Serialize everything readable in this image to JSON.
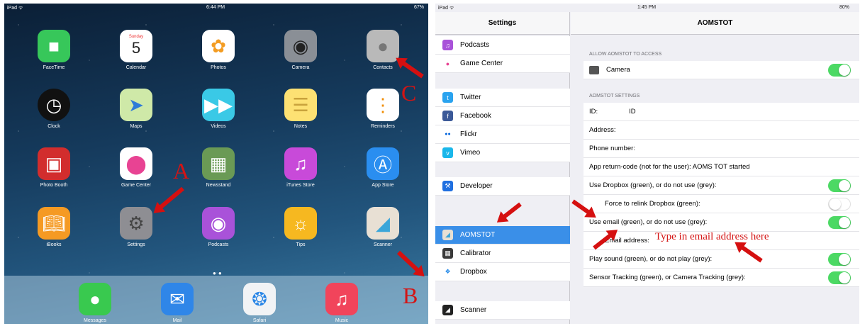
{
  "home": {
    "status": {
      "left": "iPad ᯤ",
      "time": "6:44 PM",
      "battery": "67%"
    },
    "apps": [
      {
        "label": "FaceTime",
        "icon": "facetime-icon",
        "color": "#37c75a"
      },
      {
        "label": "Calendar",
        "icon": "calendar-icon",
        "color": "#ffffff",
        "day": "Sunday",
        "date": "5"
      },
      {
        "label": "Photos",
        "icon": "photos-icon",
        "color": "#ffffff"
      },
      {
        "label": "Camera",
        "icon": "camera-icon",
        "color": "#8a8f96"
      },
      {
        "label": "Contacts",
        "icon": "contacts-icon",
        "color": "#b9b9b9"
      },
      {
        "label": "Clock",
        "icon": "clock-icon",
        "color": "#111111"
      },
      {
        "label": "Maps",
        "icon": "maps-icon",
        "color": "#cfe9a8"
      },
      {
        "label": "Videos",
        "icon": "videos-icon",
        "color": "#3ac9e6"
      },
      {
        "label": "Notes",
        "icon": "notes-icon",
        "color": "#fde173"
      },
      {
        "label": "Reminders",
        "icon": "reminders-icon",
        "color": "#ffffff"
      },
      {
        "label": "Photo Booth",
        "icon": "photo-booth-icon",
        "color": "#d22d2d"
      },
      {
        "label": "Game Center",
        "icon": "game-center-icon",
        "color": "#ffffff"
      },
      {
        "label": "Newsstand",
        "icon": "newsstand-icon",
        "color": "#6a9a55"
      },
      {
        "label": "iTunes Store",
        "icon": "itunes-store-icon",
        "color": "#c84ad9"
      },
      {
        "label": "App Store",
        "icon": "app-store-icon",
        "color": "#2a8ef0"
      },
      {
        "label": "iBooks",
        "icon": "ibooks-icon",
        "color": "#f59a23"
      },
      {
        "label": "Settings",
        "icon": "settings-icon",
        "color": "#8e8e93"
      },
      {
        "label": "Podcasts",
        "icon": "podcasts-icon",
        "color": "#a952d9"
      },
      {
        "label": "Tips",
        "icon": "tips-icon",
        "color": "#f6b820"
      },
      {
        "label": "Scanner",
        "icon": "scanner-icon",
        "color": "#e8e0d4"
      }
    ],
    "dock": [
      {
        "label": "Messages",
        "icon": "messages-icon",
        "color": "#39c94f"
      },
      {
        "label": "Mail",
        "icon": "mail-icon",
        "color": "#2f86e8"
      },
      {
        "label": "Safari",
        "icon": "safari-icon",
        "color": "#f1f3f5"
      },
      {
        "label": "Music",
        "icon": "music-icon",
        "color": "#f1445b"
      }
    ],
    "markers": {
      "a": "A",
      "b": "B",
      "c": "C"
    }
  },
  "settings": {
    "status": {
      "left": "iPad ᯤ",
      "time": "1:45 PM",
      "battery": "80%"
    },
    "master_title": "Settings",
    "master_items": [
      {
        "label": "Podcasts",
        "color": "#a952d9",
        "icon": "podcasts-icon",
        "glyph": "♫"
      },
      {
        "label": "Game Center",
        "color": "#ffffff",
        "icon": "game-center-icon",
        "glyph": "●"
      },
      {
        "label": "Twitter",
        "color": "#2aa3ef",
        "icon": "twitter-icon",
        "glyph": "t"
      },
      {
        "label": "Facebook",
        "color": "#3b5998",
        "icon": "facebook-icon",
        "glyph": "f"
      },
      {
        "label": "Flickr",
        "color": "#ffffff",
        "icon": "flickr-icon",
        "glyph": "●●"
      },
      {
        "label": "Vimeo",
        "color": "#1ab7ea",
        "icon": "vimeo-icon",
        "glyph": "v"
      },
      {
        "label": "Developer",
        "color": "#1f6fe0",
        "icon": "developer-icon",
        "glyph": "⚒"
      },
      {
        "label": "AOMSTOT",
        "color": "#e8e0d4",
        "icon": "aomstot-icon",
        "glyph": "◢"
      },
      {
        "label": "Calibrator",
        "color": "#3a3a3a",
        "icon": "calibrator-icon",
        "glyph": "▦"
      },
      {
        "label": "Dropbox",
        "color": "#ffffff",
        "icon": "dropbox-icon",
        "glyph": "❖"
      },
      {
        "label": "Scanner",
        "color": "#222222",
        "icon": "scanner-icon",
        "glyph": "◢"
      }
    ],
    "detail_title": "AOMSTOT",
    "allow_header": "ALLOW AOMSTOT TO ACCESS",
    "camera_label": "Camera",
    "settings_header": "AOMSTOT SETTINGS",
    "id_label": "ID:",
    "id_value": "ID",
    "address_label": "Address:",
    "phone_label": "Phone number:",
    "return_code": "App return-code (not for the user): AOMS TOT started",
    "dropbox_use": "Use Dropbox (green), or do not use (grey):",
    "dropbox_relink": "Force to relink Dropbox (green):",
    "email_use": "Use email (green), or do not use (grey):",
    "email_address": "Email address:",
    "play_sound": "Play sound (green), or do not play (grey):",
    "sensor_tracking": "Sensor Tracking (green), or Camera Tracking (grey):",
    "annotation": "Type in email address here"
  }
}
